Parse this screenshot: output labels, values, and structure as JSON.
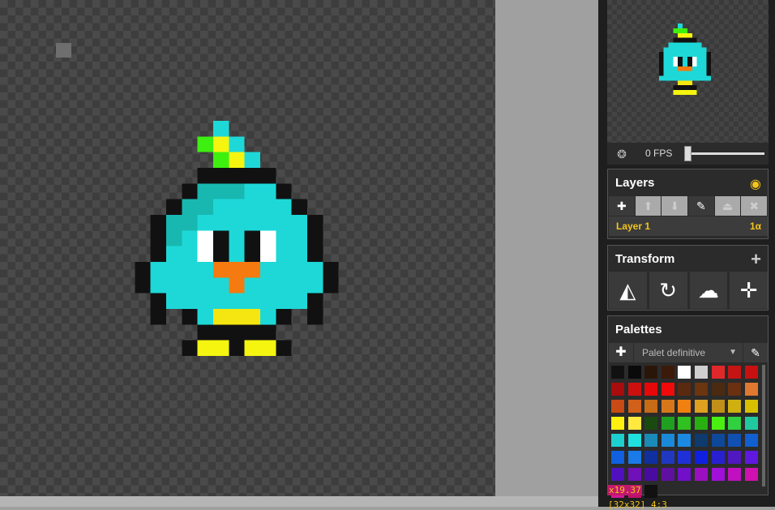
{
  "preview": {
    "fps_label": "0 FPS",
    "fps_value": 0
  },
  "layers": {
    "title": "Layers",
    "items": [
      {
        "name": "Layer 1",
        "alpha": "1α"
      }
    ]
  },
  "transform": {
    "title": "Transform"
  },
  "palettes": {
    "title": "Palettes",
    "selected": "Palet definitive",
    "colors": [
      "#111111",
      "#0a0a0a",
      "#2a1608",
      "#3b1a0a",
      "#ffffff",
      "#cfcfcf",
      "#e0282b",
      "#c41414",
      "#c81010",
      "#a80c0c",
      "#cc1010",
      "#e60808",
      "#f00a0a",
      "#5a2a10",
      "#6b3510",
      "#4a2a10",
      "#6a3010",
      "#e07830",
      "#c84a14",
      "#d0601a",
      "#c66b16",
      "#d6781a",
      "#f08010",
      "#e0a020",
      "#c09018",
      "#d0b010",
      "#d8c000",
      "#fff010",
      "#ffe840",
      "#1a4a10",
      "#20a020",
      "#30c020",
      "#28b010",
      "#4af010",
      "#30d040",
      "#20c8a0",
      "#1ecfcf",
      "#20dfdf",
      "#1a8ab8",
      "#1a8ad8",
      "#1b8ae0",
      "#0e3a6e",
      "#0e4898",
      "#1050b0",
      "#1060d0",
      "#1060e0",
      "#1a7ae8",
      "#1030a0",
      "#2038c0",
      "#2030d8",
      "#1020e0",
      "#2820d0",
      "#5018c0",
      "#6018e0",
      "#5010c0",
      "#7010b8",
      "#4a0ca0",
      "#6010a0",
      "#7010c8",
      "#9a10c0",
      "#a010d8",
      "#c010c0",
      "#d010b0",
      "#d01898",
      "#c0106a",
      "#111111"
    ]
  },
  "status": {
    "coords": "x19.37",
    "size": "[32x32] 4:3"
  }
}
